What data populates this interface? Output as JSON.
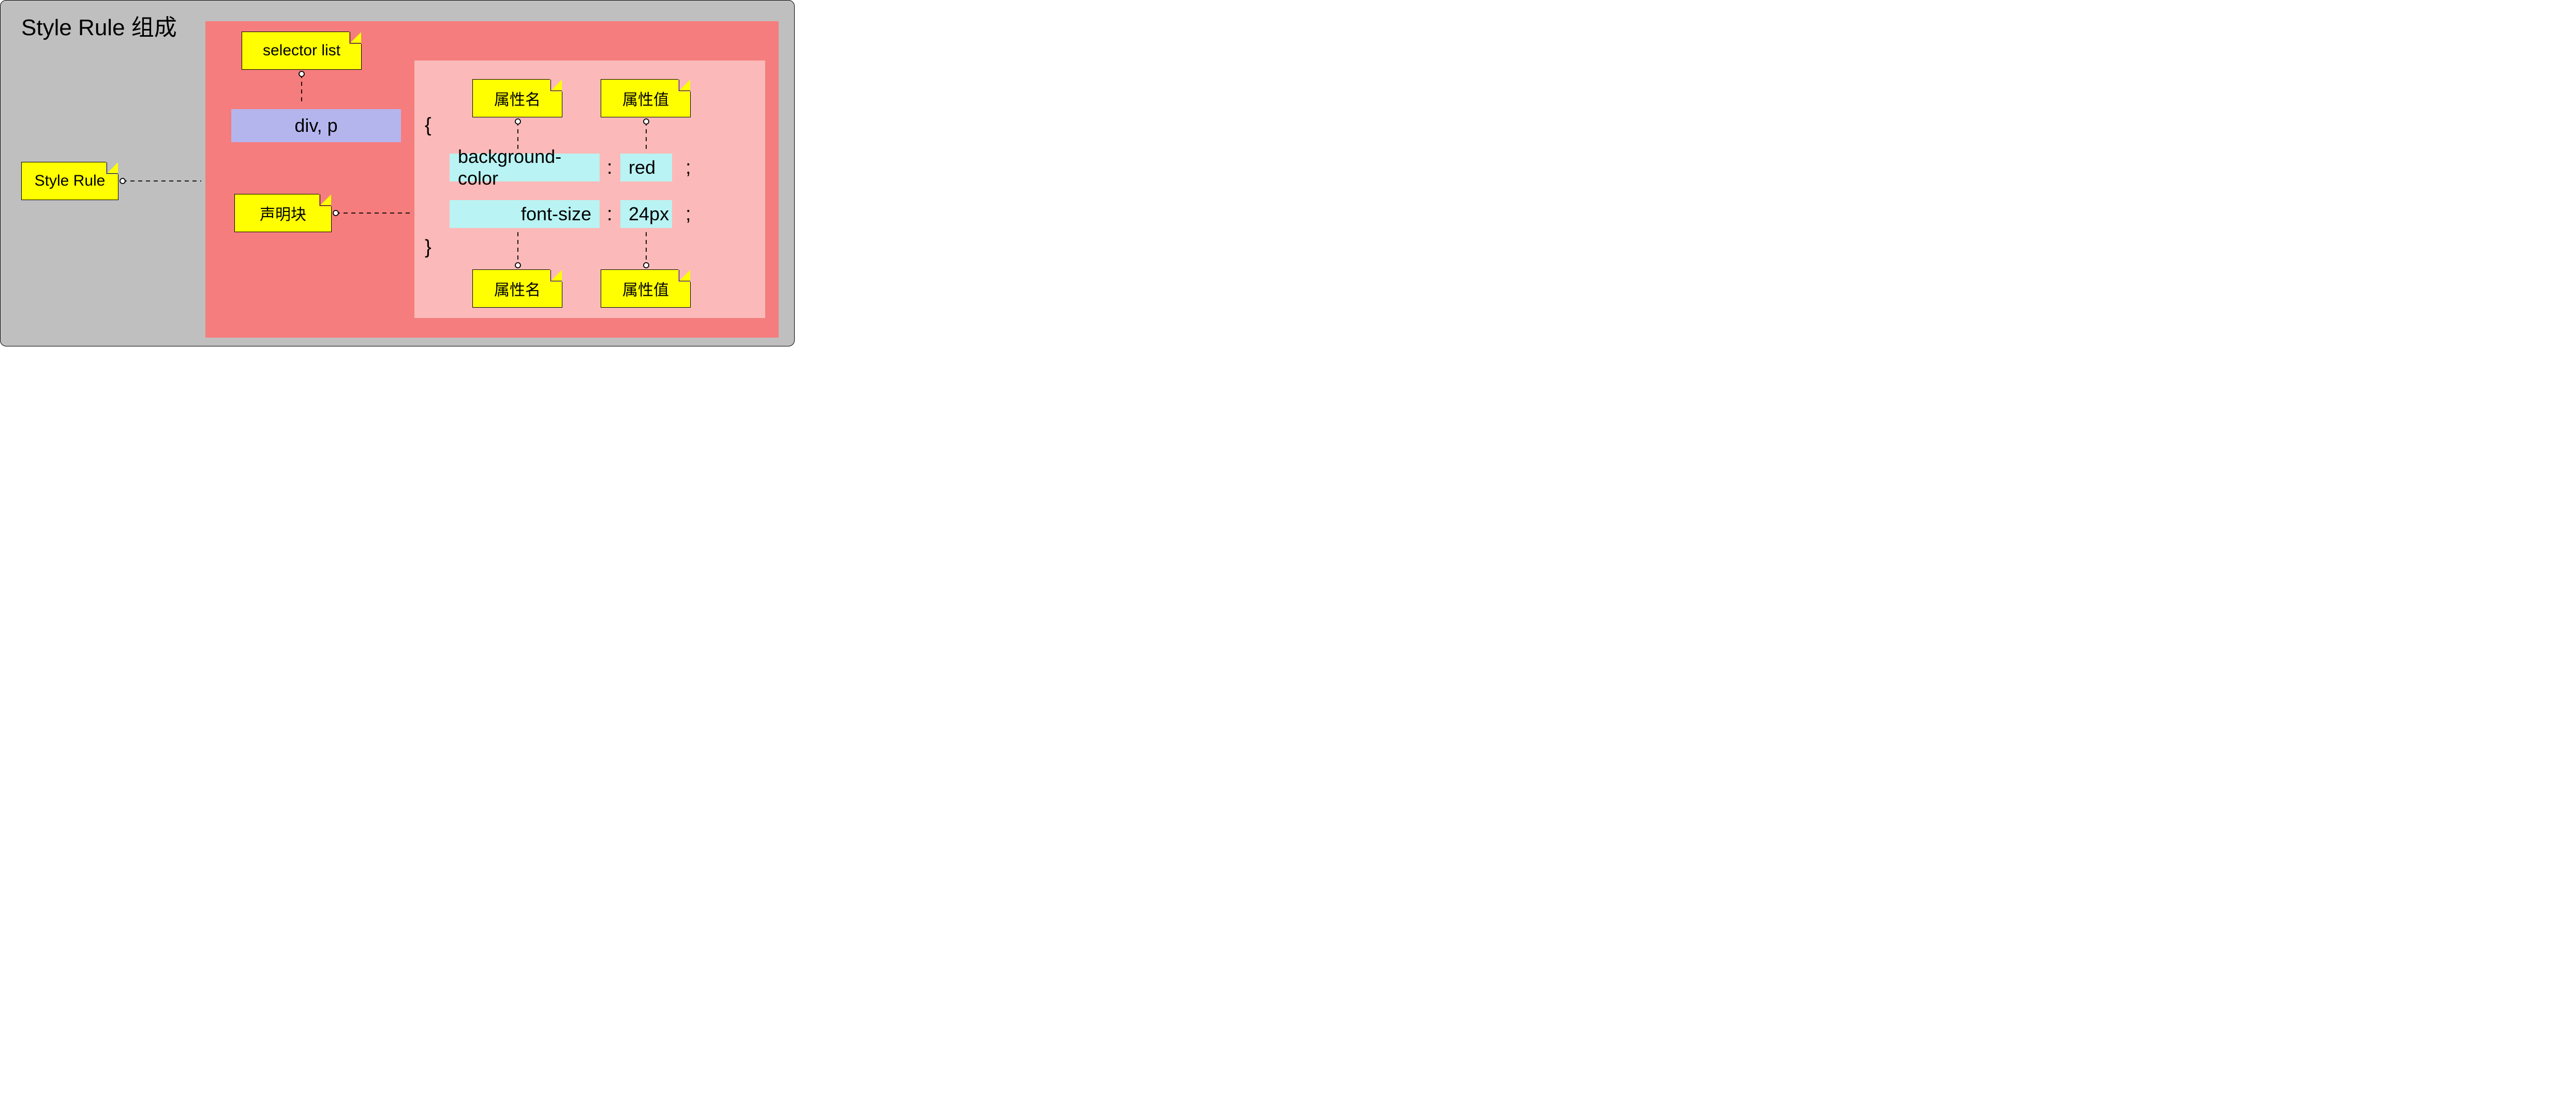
{
  "title": "Style Rule 组成",
  "notes": {
    "style_rule": "Style Rule",
    "selector_list": "selector list",
    "declaration_block": "声明块",
    "prop_name_top": "属性名",
    "prop_val_top": "属性值",
    "prop_name_bottom": "属性名",
    "prop_val_bottom": "属性值"
  },
  "selector": "div, p",
  "declarations": [
    {
      "property": "background-color",
      "value": "red"
    },
    {
      "property": "font-size",
      "value": "24px"
    }
  ],
  "punct": {
    "open": "{",
    "close": "}",
    "colon": ":",
    "semi": ";"
  }
}
